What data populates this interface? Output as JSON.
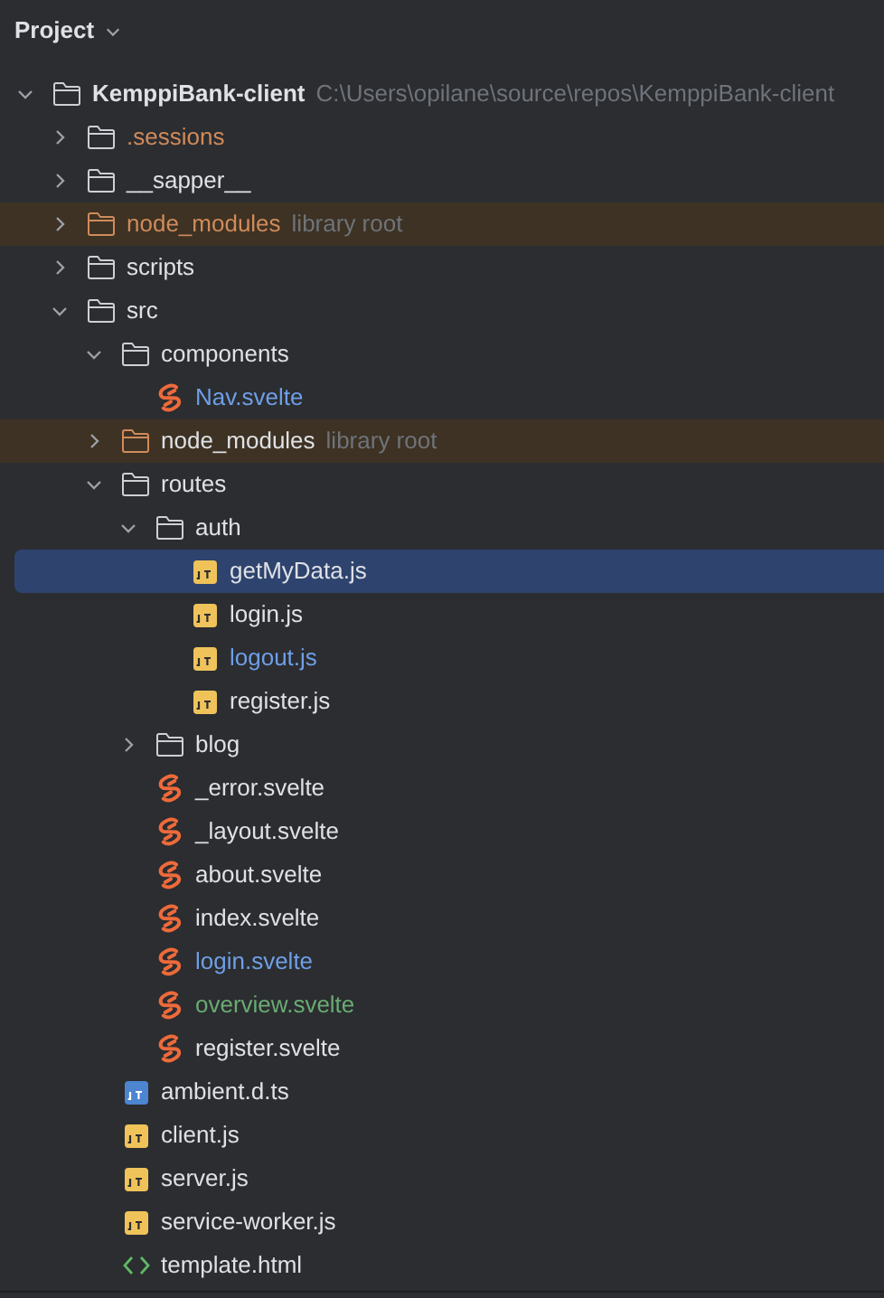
{
  "panel": {
    "title": "Project"
  },
  "tree": [
    {
      "name": "KemppiBank-client",
      "kind": "folder",
      "bold": true,
      "hint": "C:\\Users\\opilane\\source\\repos\\KemppiBank-client",
      "expanded": true,
      "selected": false,
      "excluded": false,
      "color": "#dfe1e5",
      "children": [
        {
          "name": ".sessions",
          "kind": "folder",
          "expanded": false,
          "selected": false,
          "excluded": false,
          "color": "#d08b5b"
        },
        {
          "name": "__sapper__",
          "kind": "folder",
          "expanded": false,
          "selected": false,
          "excluded": false,
          "color": "#dfe1e5"
        },
        {
          "name": "node_modules",
          "kind": "folder",
          "hint": "library root",
          "expanded": false,
          "selected": false,
          "excluded": true,
          "color": "#d08b5b"
        },
        {
          "name": "scripts",
          "kind": "folder",
          "expanded": false,
          "selected": false,
          "excluded": false,
          "color": "#dfe1e5"
        },
        {
          "name": "src",
          "kind": "folder",
          "expanded": true,
          "selected": false,
          "excluded": false,
          "color": "#dfe1e5",
          "children": [
            {
              "name": "components",
              "kind": "folder",
              "expanded": true,
              "selected": false,
              "excluded": false,
              "color": "#dfe1e5",
              "children": [
                {
                  "name": "Nav.svelte",
                  "kind": "svelte",
                  "selected": false,
                  "excluded": false,
                  "color": "#6f9fe8"
                }
              ]
            },
            {
              "name": "node_modules",
              "kind": "folder",
              "hint": "library root",
              "expanded": false,
              "selected": false,
              "excluded": true,
              "color": "#dfe1e5"
            },
            {
              "name": "routes",
              "kind": "folder",
              "expanded": true,
              "selected": false,
              "excluded": false,
              "color": "#dfe1e5",
              "children": [
                {
                  "name": "auth",
                  "kind": "folder",
                  "expanded": true,
                  "selected": false,
                  "excluded": false,
                  "color": "#dfe1e5",
                  "children": [
                    {
                      "name": "getMyData.js",
                      "kind": "js",
                      "selected": true,
                      "excluded": false,
                      "color": "#dfe1e5"
                    },
                    {
                      "name": "login.js",
                      "kind": "js",
                      "selected": false,
                      "excluded": false,
                      "color": "#dfe1e5"
                    },
                    {
                      "name": "logout.js",
                      "kind": "js",
                      "selected": false,
                      "excluded": false,
                      "color": "#6f9fe8"
                    },
                    {
                      "name": "register.js",
                      "kind": "js",
                      "selected": false,
                      "excluded": false,
                      "color": "#dfe1e5"
                    }
                  ]
                },
                {
                  "name": "blog",
                  "kind": "folder",
                  "expanded": false,
                  "selected": false,
                  "excluded": false,
                  "color": "#dfe1e5"
                },
                {
                  "name": "_error.svelte",
                  "kind": "svelte",
                  "selected": false,
                  "excluded": false,
                  "color": "#dfe1e5"
                },
                {
                  "name": "_layout.svelte",
                  "kind": "svelte",
                  "selected": false,
                  "excluded": false,
                  "color": "#dfe1e5"
                },
                {
                  "name": "about.svelte",
                  "kind": "svelte",
                  "selected": false,
                  "excluded": false,
                  "color": "#dfe1e5"
                },
                {
                  "name": "index.svelte",
                  "kind": "svelte",
                  "selected": false,
                  "excluded": false,
                  "color": "#dfe1e5"
                },
                {
                  "name": "login.svelte",
                  "kind": "svelte",
                  "selected": false,
                  "excluded": false,
                  "color": "#6f9fe8"
                },
                {
                  "name": "overview.svelte",
                  "kind": "svelte",
                  "selected": false,
                  "excluded": false,
                  "color": "#6aab73"
                },
                {
                  "name": "register.svelte",
                  "kind": "svelte",
                  "selected": false,
                  "excluded": false,
                  "color": "#dfe1e5"
                }
              ]
            },
            {
              "name": "ambient.d.ts",
              "kind": "ts",
              "selected": false,
              "excluded": false,
              "color": "#dfe1e5"
            },
            {
              "name": "client.js",
              "kind": "js",
              "selected": false,
              "excluded": false,
              "color": "#dfe1e5"
            },
            {
              "name": "server.js",
              "kind": "js",
              "selected": false,
              "excluded": false,
              "color": "#dfe1e5"
            },
            {
              "name": "service-worker.js",
              "kind": "js",
              "selected": false,
              "excluded": false,
              "color": "#dfe1e5"
            },
            {
              "name": "template.html",
              "kind": "html",
              "selected": false,
              "excluded": false,
              "color": "#dfe1e5"
            }
          ]
        }
      ]
    }
  ]
}
